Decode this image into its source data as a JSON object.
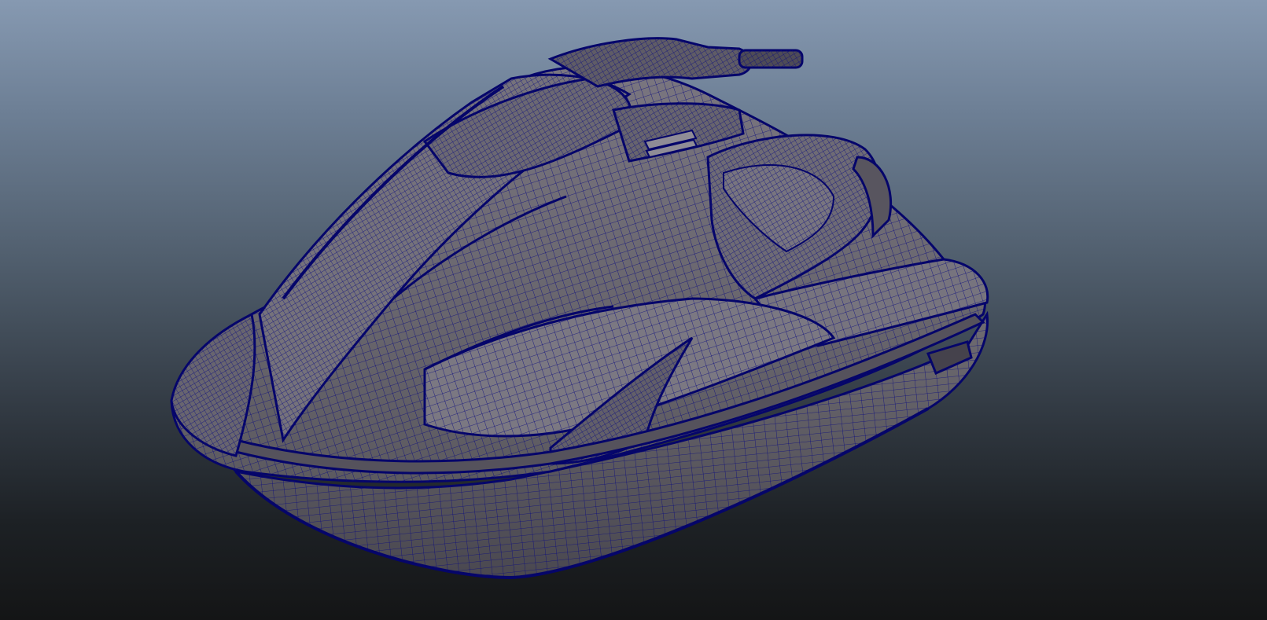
{
  "viewport": {
    "content": "3d-wireframe-model",
    "shading": "wireframe-on-shaded"
  },
  "colors": {
    "background_top": "#8699b1",
    "background_bottom": "#141516",
    "model_surface": "#6f6c72",
    "wire": "#0b0b7e",
    "edge": "#05056a"
  }
}
